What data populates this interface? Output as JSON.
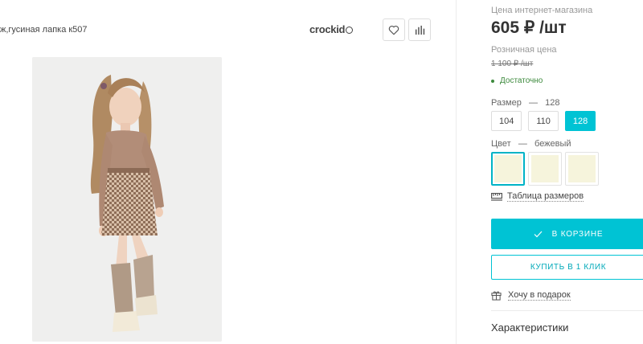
{
  "product": {
    "title": "ж,гусиная лапка к507",
    "brand": "crockid"
  },
  "actions": {
    "favorite_icon": "heart-icon",
    "compare_icon": "bar-chart-icon"
  },
  "pricing": {
    "online_label": "Цена интернет-магазина",
    "online_price": "605 ₽ /шт",
    "retail_label": "Розничная цена",
    "retail_price": "1 100 ₽ /шт",
    "stock": "Достаточно",
    "stock_color": "#3d8a3d"
  },
  "size": {
    "label": "Размер",
    "selected": "128",
    "options": [
      "104",
      "110",
      "128"
    ]
  },
  "color": {
    "label": "Цвет",
    "selected": "бежевый",
    "swatches": [
      "#f6f4dc",
      "#f6f4dc",
      "#f6f4dc"
    ]
  },
  "size_table": "Таблица размеров",
  "buttons": {
    "cart": "В КОРЗИНЕ",
    "one_click": "КУПИТЬ В 1 КЛИК",
    "accent": "#00c3d4"
  },
  "gift": "Хочу в подарок",
  "specs_heading": "Характеристики"
}
